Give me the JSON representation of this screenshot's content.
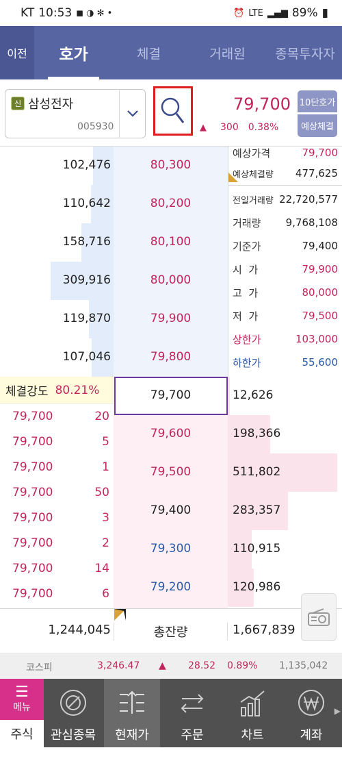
{
  "status_bar": {
    "carrier": "KT",
    "time": "10:53",
    "network": "LTE",
    "battery": "89%"
  },
  "tabs": {
    "prev_label": "이전",
    "items": [
      {
        "label": "호가",
        "active": true
      },
      {
        "label": "체결",
        "active": false
      },
      {
        "label": "거래원",
        "active": false
      },
      {
        "label": "종목투자자",
        "active": false
      }
    ]
  },
  "stock": {
    "badge": "신",
    "name": "삼성전자",
    "code": "005930",
    "price": "79,700",
    "change": "300",
    "change_pct": "0.38%",
    "btn_10": "10단호가",
    "btn_expected": "예상체결"
  },
  "asks": [
    {
      "qty": "102,476",
      "price": "80,300",
      "level": 0.33
    },
    {
      "qty": "110,642",
      "price": "80,200",
      "level": 0.36
    },
    {
      "qty": "158,716",
      "price": "80,100",
      "level": 0.51
    },
    {
      "qty": "309,916",
      "price": "80,000",
      "level": 1.0
    },
    {
      "qty": "119,870",
      "price": "79,900",
      "level": 0.39
    },
    {
      "qty": "107,046",
      "price": "79,800",
      "level": 0.35
    }
  ],
  "info": {
    "expected_price_label": "예상가격",
    "expected_price": "79,700",
    "expected_vol_label": "예상체결량",
    "expected_vol": "477,625",
    "rows": [
      {
        "label": "전일거래량",
        "value": "22,720,577",
        "color": "#222222"
      },
      {
        "label": "거래량",
        "value": "9,768,108",
        "color": "#222222"
      },
      {
        "label": "기준가",
        "value": "79,400",
        "color": "#222222"
      },
      {
        "label": "시  가",
        "value": "79,900",
        "color": "#c2255c"
      },
      {
        "label": "고  가",
        "value": "80,000",
        "color": "#c2255c"
      },
      {
        "label": "저  가",
        "value": "79,500",
        "color": "#c2255c"
      },
      {
        "label": "상한가",
        "value": "103,000",
        "color": "#c2255c",
        "label_color": "#c2255c"
      },
      {
        "label": "하한가",
        "value": "55,600",
        "color": "#2a5aa8",
        "label_color": "#2a5aa8"
      }
    ]
  },
  "strength": {
    "label": "체결강도",
    "value": "80.21%"
  },
  "ticks": [
    {
      "price": "79,700",
      "qty": "20"
    },
    {
      "price": "79,700",
      "qty": "5"
    },
    {
      "price": "79,700",
      "qty": "1"
    },
    {
      "price": "79,700",
      "qty": "50"
    },
    {
      "price": "79,700",
      "qty": "3"
    },
    {
      "price": "79,700",
      "qty": "2"
    },
    {
      "price": "79,700",
      "qty": "14"
    },
    {
      "price": "79,700",
      "qty": "6"
    }
  ],
  "bids": [
    {
      "price": "79,700",
      "qty": "12,626",
      "color": "#222222",
      "level": 0.02
    },
    {
      "price": "79,600",
      "qty": "198,366",
      "color": "#c2255c",
      "level": 0.39
    },
    {
      "price": "79,500",
      "qty": "511,802",
      "color": "#c2255c",
      "level": 1.0
    },
    {
      "price": "79,400",
      "qty": "283,357",
      "color": "#222222",
      "level": 0.55
    },
    {
      "price": "79,300",
      "qty": "110,915",
      "color": "#2a5aa8",
      "level": 0.22
    },
    {
      "price": "79,200",
      "qty": "120,986",
      "color": "#2a5aa8",
      "level": 0.24
    }
  ],
  "totals": {
    "ask_total": "1,244,045",
    "label": "총잔량",
    "bid_total": "1,667,839"
  },
  "index": {
    "name": "코스피",
    "value": "3,246.47",
    "change": "28.52",
    "change_pct": "0.89%",
    "volume": "1,135,042"
  },
  "bottom_nav": {
    "menu_label": "메뉴",
    "menu_sub": "주식",
    "items": [
      {
        "label": "관심종목",
        "icon": "target-icon",
        "active": false
      },
      {
        "label": "현재가",
        "icon": "current-price-icon",
        "active": true
      },
      {
        "label": "주문",
        "icon": "order-icon",
        "active": false
      },
      {
        "label": "차트",
        "icon": "chart-icon",
        "active": false
      },
      {
        "label": "계좌",
        "icon": "won-icon",
        "active": false
      }
    ]
  }
}
